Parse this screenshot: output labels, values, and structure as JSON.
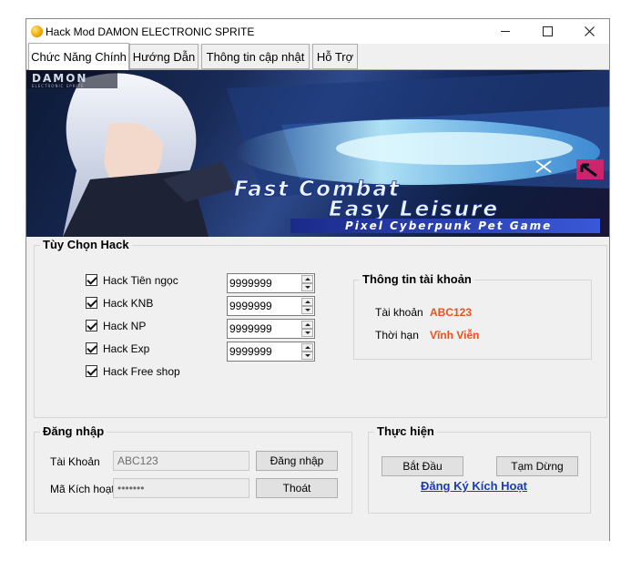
{
  "window": {
    "title": "Hack Mod DAMON ELECTRONIC SPRITE"
  },
  "tabs": [
    {
      "label": "Chức Năng Chính"
    },
    {
      "label": "Hướng Dẫn"
    },
    {
      "label": "Thông tin cập nhật"
    },
    {
      "label": "Hỗ Trợ"
    }
  ],
  "banner": {
    "logo_main": "DAMON",
    "logo_sub": "ELECTRONIC SPRITE",
    "headline_1": "Fast Combat",
    "headline_2": "Easy Leisure",
    "tagline": "Pixel Cyberpunk Pet Game"
  },
  "hack_options": {
    "title": "Tùy Chọn Hack",
    "items": [
      {
        "label": "Hack Tiên ngọc",
        "checked": true,
        "value": "9999999"
      },
      {
        "label": "Hack KNB",
        "checked": true,
        "value": "9999999"
      },
      {
        "label": "Hack NP",
        "checked": true,
        "value": "9999999"
      },
      {
        "label": "Hack Exp",
        "checked": true,
        "value": "9999999"
      },
      {
        "label": "Hack Free shop",
        "checked": true
      }
    ]
  },
  "account_info": {
    "title": "Thông tin tài khoản",
    "account_label": "Tài khoản",
    "account_value": "ABC123",
    "duration_label": "Thời hạn",
    "duration_value": "Vĩnh Viễn",
    "value_color": "#e8521c"
  },
  "login": {
    "title": "Đăng nhập",
    "account_label": "Tài Khoản",
    "account_value": "ABC123",
    "code_label": "Mã Kích hoạt",
    "code_value": "•••••••",
    "login_button": "Đăng nhập",
    "exit_button": "Thoát"
  },
  "actions": {
    "title": "Thực hiện",
    "start_button": "Bắt Đầu",
    "pause_button": "Tạm Dừng",
    "register_link": "Đăng Ký Kích Hoạt",
    "link_color": "#1b3bb5"
  }
}
